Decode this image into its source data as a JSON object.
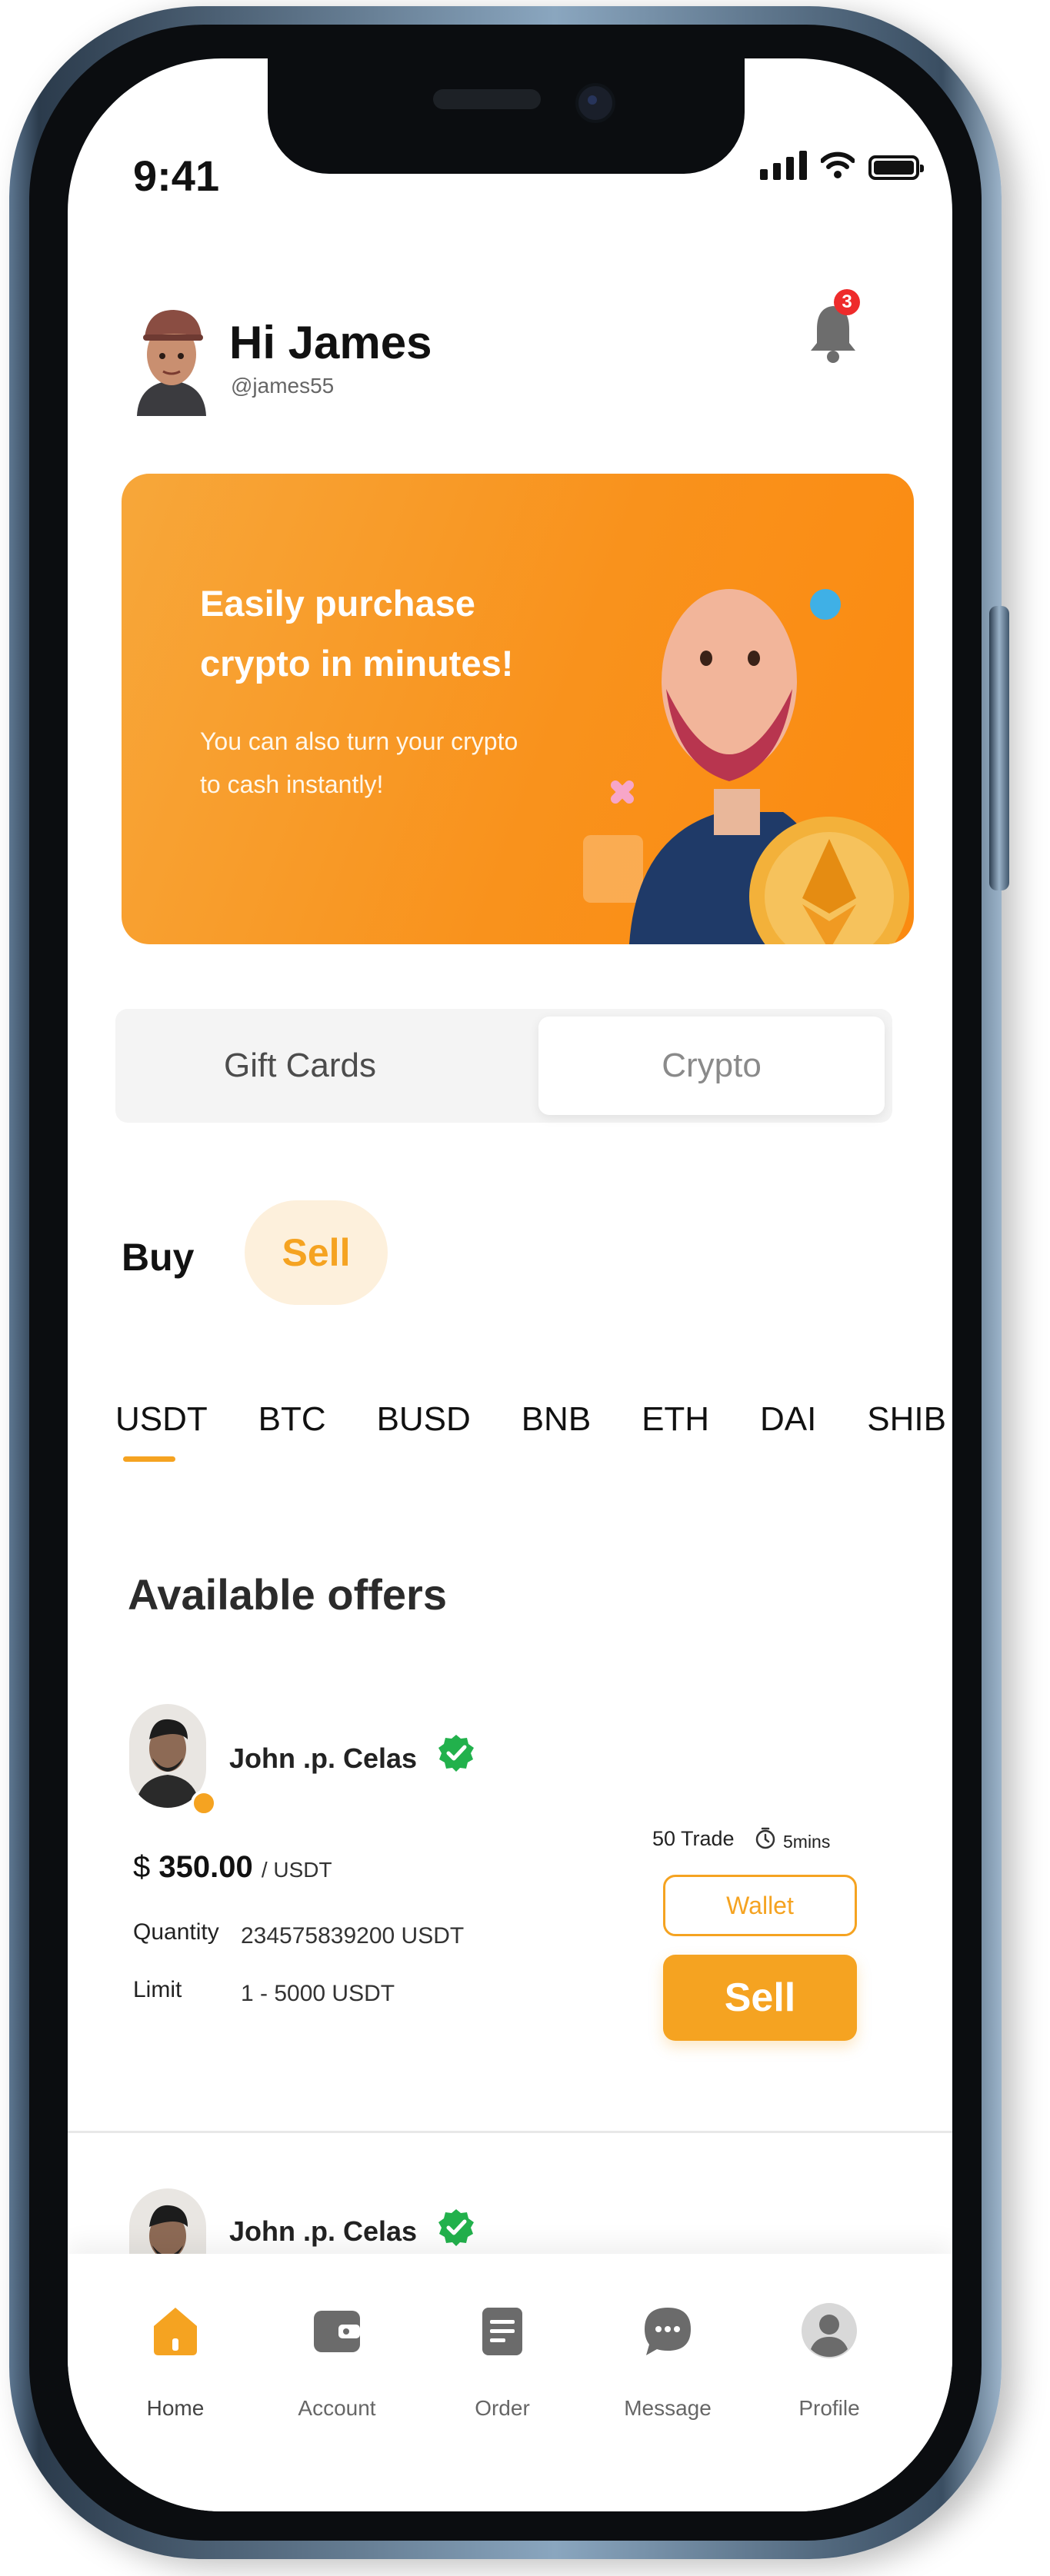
{
  "status_bar": {
    "time": "9:41"
  },
  "header": {
    "greeting": "Hi James",
    "handle": "@james55",
    "notification_count": "3"
  },
  "banner": {
    "title": "Easily purchase crypto in minutes!",
    "subtitle": "You can also turn your crypto to cash instantly!"
  },
  "segment": {
    "gift_cards": "Gift Cards",
    "crypto": "Crypto",
    "selected": "Crypto"
  },
  "mode": {
    "buy": "Buy",
    "sell": "Sell",
    "selected": "Sell"
  },
  "coins": {
    "items": [
      "USDT",
      "BTC",
      "BUSD",
      "BNB",
      "ETH",
      "DAI",
      "SHIB"
    ],
    "selected": "USDT"
  },
  "offers": {
    "title": "Available offers",
    "items": [
      {
        "name": "John .p. Celas",
        "currency_symbol": "$",
        "price": "350.00",
        "price_unit": "/ USDT",
        "quantity_label": "Quantity",
        "quantity": "234575839200 USDT",
        "limit_label": "Limit",
        "limit": "1 - 5000 USDT",
        "trades": "50 Trade",
        "duration": "5mins",
        "wallet_label": "Wallet",
        "action_label": "Sell"
      },
      {
        "name": "John .p. Celas"
      }
    ]
  },
  "nav": {
    "items": [
      {
        "label": "Home",
        "icon": "home-icon",
        "active": true
      },
      {
        "label": "Account",
        "icon": "wallet-icon",
        "active": false
      },
      {
        "label": "Order",
        "icon": "document-icon",
        "active": false
      },
      {
        "label": "Message",
        "icon": "chat-icon",
        "active": false
      },
      {
        "label": "Profile",
        "icon": "user-icon",
        "active": false
      }
    ]
  },
  "colors": {
    "accent": "#f5a321",
    "badge": "#ee2b2b",
    "verified": "#22b14c"
  }
}
